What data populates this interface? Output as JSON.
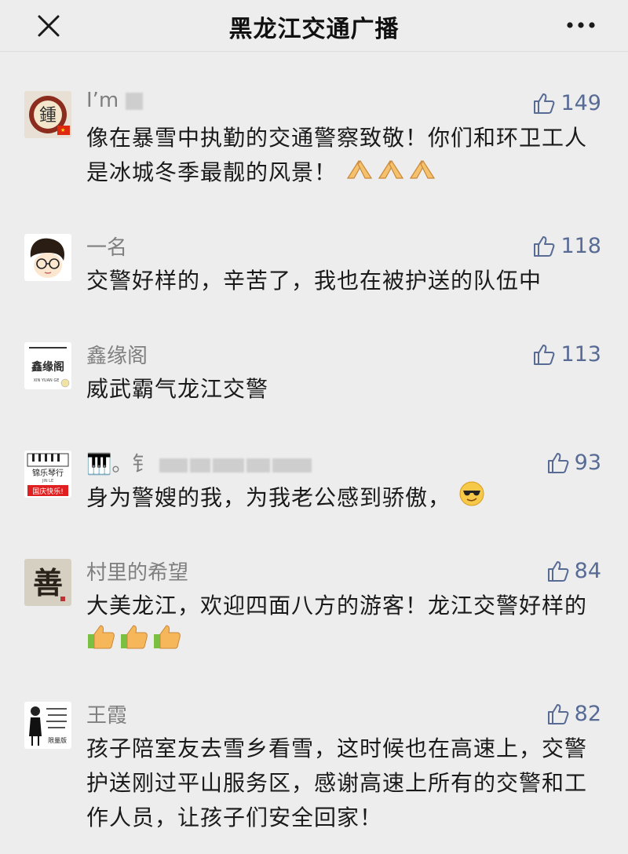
{
  "header": {
    "title": "黑龙江交通广播",
    "close_icon": "close-icon",
    "more_icon": "more-icon"
  },
  "comments": [
    {
      "name": "I’m",
      "likes": "149",
      "text": "像在暴雪中执勤的交通警察致敬！你们和环卫工人是冰城冬季最靓的风景！",
      "emoji": "pray-hands-icon",
      "avatar_text": "鍾"
    },
    {
      "name": "一名",
      "likes": "118",
      "text": "交警好样的，辛苦了，我也在被护送的队伍中",
      "avatar_text": ""
    },
    {
      "name": "鑫缘阁",
      "likes": "113",
      "text": "威武霸气龙江交警",
      "avatar_text": "鑫缘阁",
      "avatar_sub": "XIN YUAN GE"
    },
    {
      "name": "🎹。钅",
      "likes": "93",
      "text": "身为警嫂的我，为我老公感到骄傲，",
      "emoji": "cool-face-icon",
      "avatar_text": "锦乐琴行",
      "avatar_sub": "JIN LE",
      "avatar_banner": "国庆快乐!"
    },
    {
      "name": "村里的希望",
      "likes": "84",
      "text": "大美龙江，欢迎四面八方的游客！龙江交警好样的",
      "emoji": "thumbs-up-icon",
      "avatar_text": "善"
    },
    {
      "name": "王霞",
      "likes": "82",
      "text": "孩子陪室友去雪乡看雪，这时候也在高速上，交警护送刚过平山服务区，感谢高速上所有的交警和工作人员，让孩子们安全回家！",
      "avatar_text": "限量版"
    }
  ],
  "colors": {
    "link": "#576b95",
    "bg": "#ededed",
    "name": "#7f7f7f"
  }
}
